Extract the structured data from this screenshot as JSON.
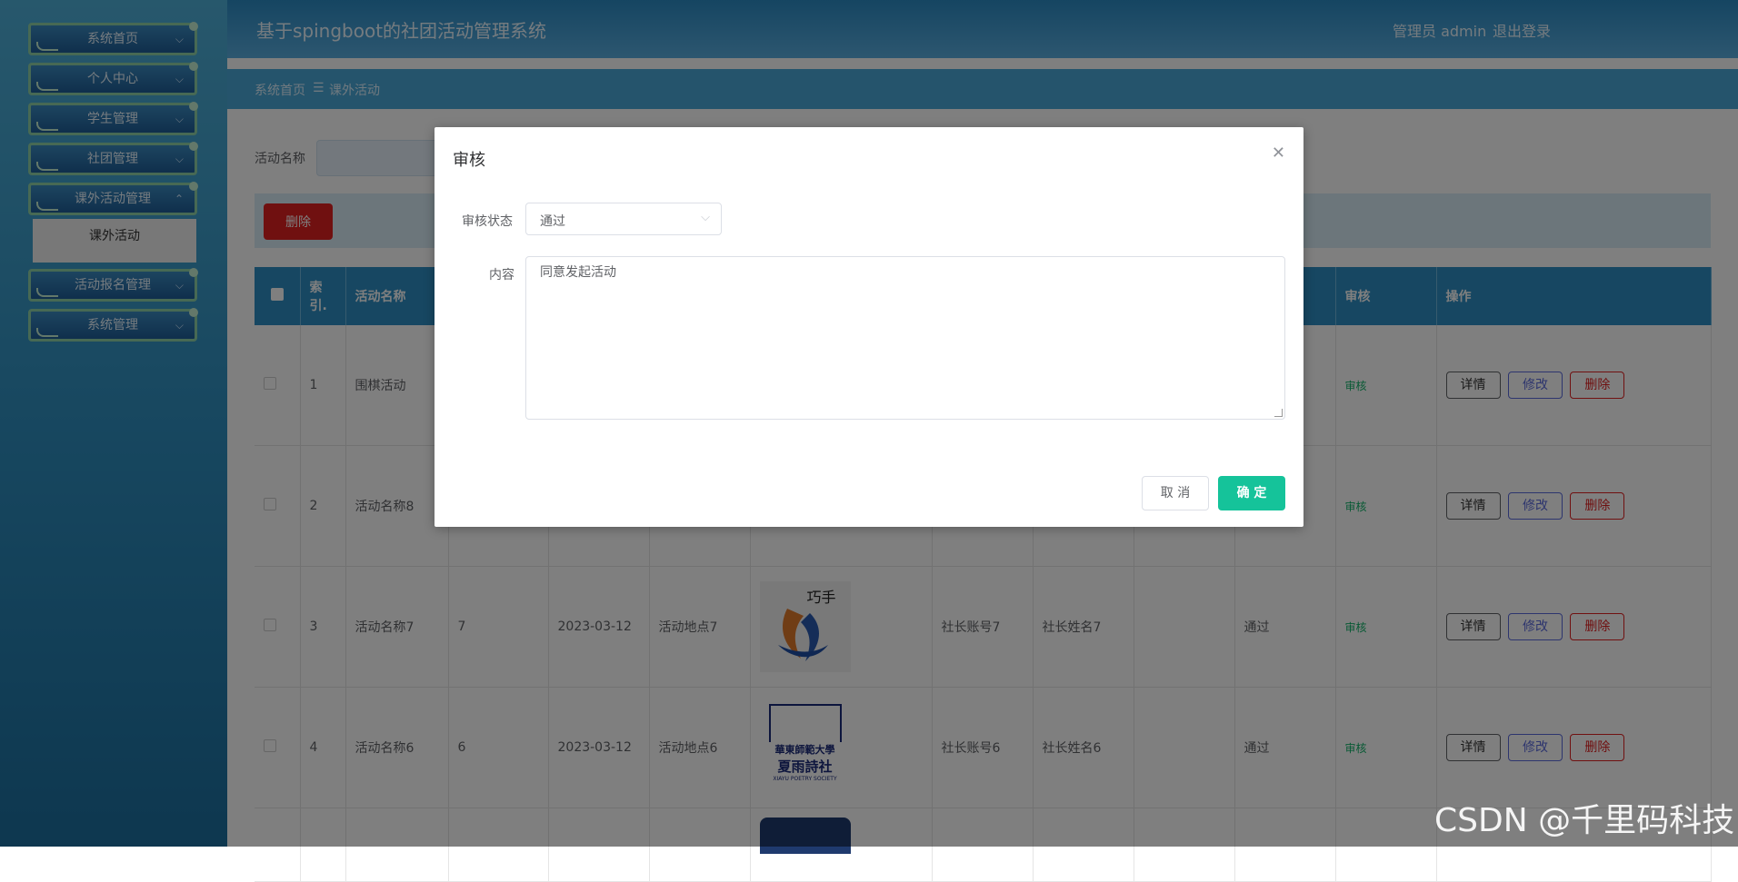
{
  "app": {
    "title": "基于spingboot的社团活动管理系统",
    "user": "管理员 admin",
    "logout": "退出登录"
  },
  "sidebar": {
    "items": [
      {
        "label": "系统首页"
      },
      {
        "label": "个人中心"
      },
      {
        "label": "学生管理"
      },
      {
        "label": "社团管理"
      },
      {
        "label": "课外活动管理"
      },
      {
        "label": "活动报名管理"
      },
      {
        "label": "系统管理"
      }
    ],
    "active_sub": "课外活动"
  },
  "breadcrumb": {
    "home": "系统首页",
    "sep": "☰",
    "current": "课外活动"
  },
  "search": {
    "label": "活动名称",
    "placeholder": ""
  },
  "toolbar": {
    "delete_label": "删除"
  },
  "table": {
    "headers": {
      "index": "索\n引.",
      "name": "活动名称",
      "audit": "审核",
      "ops": "操作"
    },
    "rows": [
      {
        "index": "1",
        "name": "围棋活动",
        "num": "",
        "date": "",
        "place": "",
        "acct": "",
        "leader": "",
        "status": "",
        "audit": "审核"
      },
      {
        "index": "2",
        "name": "活动名称8",
        "num": "",
        "date": "",
        "place": "",
        "acct": "",
        "leader": "",
        "status": "",
        "audit": "审核"
      },
      {
        "index": "3",
        "name": "活动名称7",
        "num": "7",
        "date": "2023-03-12",
        "place": "活动地点7",
        "acct": "社长账号7",
        "leader": "社长姓名7",
        "status": "通过",
        "audit": "审核"
      },
      {
        "index": "4",
        "name": "活动名称6",
        "num": "6",
        "date": "2023-03-12",
        "place": "活动地点6",
        "acct": "社长账号6",
        "leader": "社长姓名6",
        "status": "通过",
        "audit": "审核"
      }
    ],
    "logo_texts": {
      "row3": "巧手",
      "row4_line1": "華東師範大學",
      "row4_line2": "夏雨詩社",
      "row4_line3": "XIAYU POETRY SOCIETY"
    },
    "op_labels": {
      "detail": "详情",
      "edit": "修改",
      "delete": "删除"
    }
  },
  "modal": {
    "title": "审核",
    "status_label": "审核状态",
    "status_value": "通过",
    "content_label": "内容",
    "content_value": "同意发起活动",
    "cancel": "取 消",
    "ok": "确 定"
  },
  "watermark": "CSDN @千里码科技",
  "colors": {
    "accent": "#2f8fc4",
    "ok_button": "#15c39a",
    "delete": "#e02020",
    "audit_link": "#13b46a"
  }
}
